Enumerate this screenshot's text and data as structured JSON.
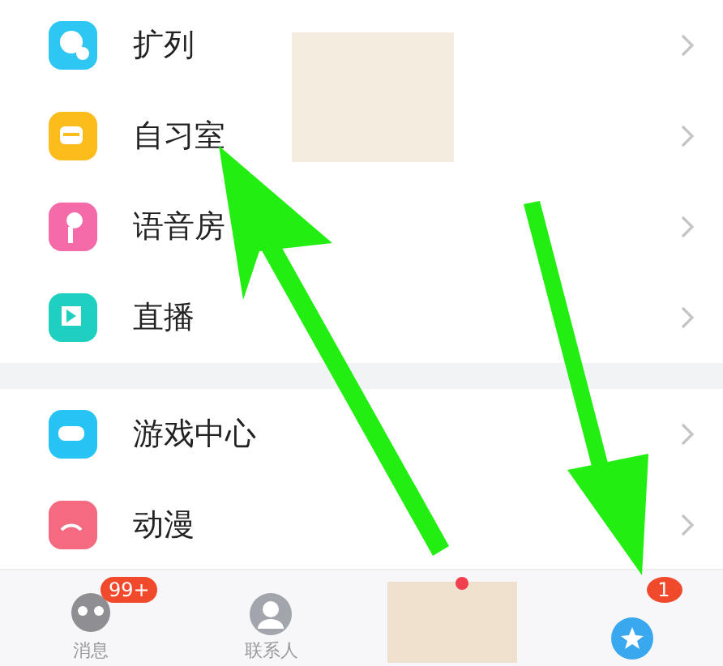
{
  "menu_sections": [
    {
      "items": [
        {
          "label": "扩列"
        },
        {
          "label": "自习室"
        },
        {
          "label": "语音房"
        },
        {
          "label": "直播"
        }
      ]
    },
    {
      "items": [
        {
          "label": "游戏中心"
        },
        {
          "label": "动漫"
        }
      ]
    }
  ],
  "tab_bar": [
    {
      "kind": "messages",
      "label": "消息",
      "badge": "99+"
    },
    {
      "kind": "contacts",
      "label": "联系人"
    },
    {
      "kind": "hidden"
    },
    {
      "kind": "star",
      "badge": "1"
    }
  ]
}
